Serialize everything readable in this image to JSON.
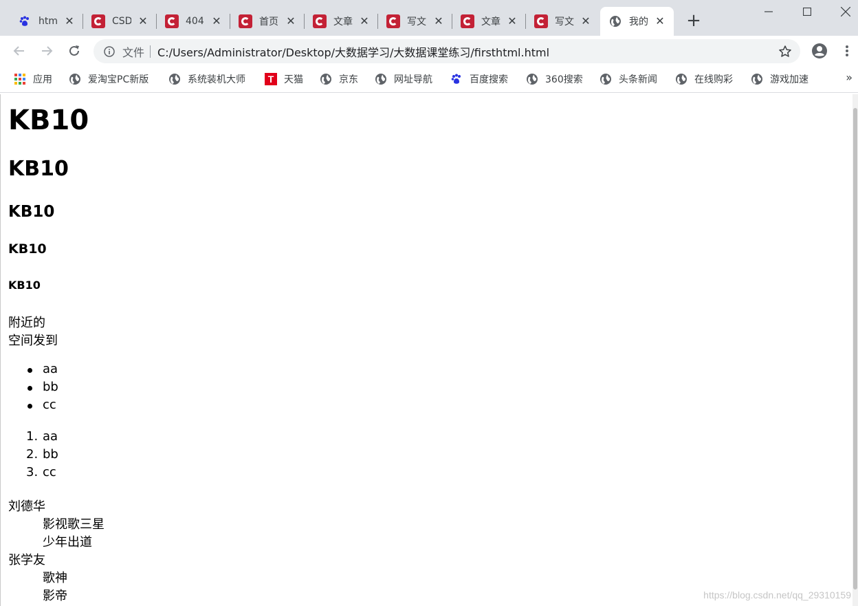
{
  "tabs": [
    {
      "title": "htm",
      "icon": "baidu-paw-icon"
    },
    {
      "title": "CSD",
      "icon": "csdn-logo-icon"
    },
    {
      "title": "404",
      "icon": "csdn-logo-icon"
    },
    {
      "title": "首页",
      "icon": "csdn-logo-icon"
    },
    {
      "title": "文章",
      "icon": "csdn-logo-icon"
    },
    {
      "title": "写文",
      "icon": "csdn-logo-icon"
    },
    {
      "title": "文章",
      "icon": "csdn-logo-icon"
    },
    {
      "title": "写文",
      "icon": "csdn-logo-icon"
    },
    {
      "title": "我的",
      "icon": "globe-icon",
      "active": true
    }
  ],
  "omnibox": {
    "scheme": "文件",
    "url": "C:/Users/Administrator/Desktop/大数据学习/大数据课堂练习/firsthtml.html"
  },
  "bookmarks": [
    {
      "label": "应用",
      "icon": "apps-grid-icon"
    },
    {
      "label": "爱淘宝PC新版",
      "icon": "globe-icon"
    },
    {
      "label": "系统装机大师",
      "icon": "globe-icon"
    },
    {
      "label": "天猫",
      "icon": "tmall-icon"
    },
    {
      "label": "京东",
      "icon": "globe-icon"
    },
    {
      "label": "网址导航",
      "icon": "globe-icon"
    },
    {
      "label": "百度搜索",
      "icon": "baidu-paw-icon"
    },
    {
      "label": "360搜索",
      "icon": "globe-icon"
    },
    {
      "label": "头条新闻",
      "icon": "globe-icon"
    },
    {
      "label": "在线购彩",
      "icon": "globe-icon"
    },
    {
      "label": "游戏加速",
      "icon": "globe-icon"
    }
  ],
  "content": {
    "headings": [
      "KB10",
      "KB10",
      "KB10",
      "KB10",
      "KB10"
    ],
    "paragraph_lines": [
      "附近的",
      "空间发到"
    ],
    "unordered_list": [
      "aa",
      "bb",
      "cc"
    ],
    "ordered_list": [
      "aa",
      "bb",
      "cc"
    ],
    "ordered_markers": [
      "1.",
      "2.",
      "3."
    ],
    "definition_list": [
      {
        "term": "刘德华",
        "details": [
          "影视歌三星",
          "少年出道"
        ]
      },
      {
        "term": "张学友",
        "details": [
          "歌神",
          "影帝"
        ]
      }
    ]
  },
  "watermark": "https://blog.csdn.net/qq_29310159",
  "colors": {
    "csdn_red": "#c32136",
    "tab_strip": "#dee1e6",
    "omnibox": "#f1f3f4"
  }
}
